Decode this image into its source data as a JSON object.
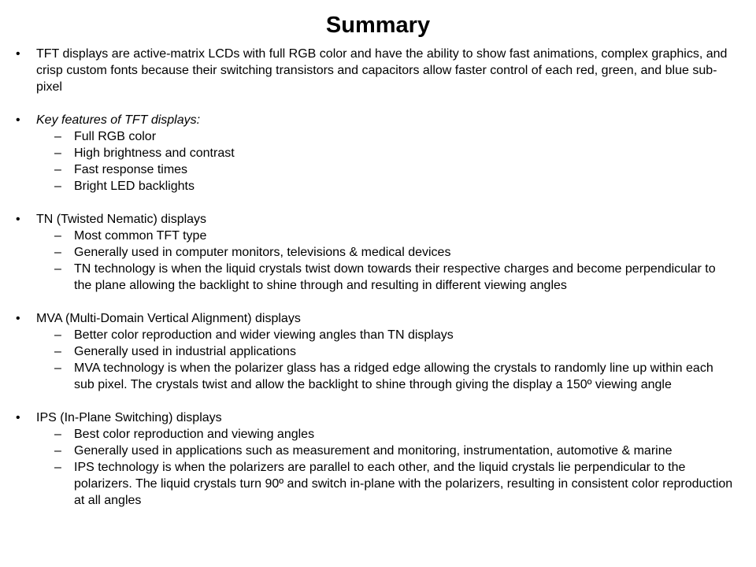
{
  "slide": {
    "title": "Summary",
    "bullet_marker": "•",
    "sub_bullet_marker": "–",
    "text_color": "#000000",
    "background_color": "#ffffff",
    "groups": [
      {
        "id": "tft-overview",
        "lead": {
          "text": "TFT displays are active-matrix LCDs with full RGB color and have the ability to show fast animations, complex graphics, and crisp custom fonts because their switching transistors and capacitors allow faster control of each red, green, and blue sub-pixel",
          "style": "normal"
        },
        "subs": []
      },
      {
        "id": "key-features",
        "lead": {
          "text": "Key features of TFT displays:",
          "style": "italic"
        },
        "subs": [
          "Full RGB color",
          "High brightness and contrast",
          "Fast response times",
          "Bright LED backlights"
        ]
      },
      {
        "id": "tn-displays",
        "lead": {
          "text": "TN (Twisted Nematic) displays",
          "style": "normal"
        },
        "subs": [
          "Most common TFT type",
          "Generally used in computer monitors, televisions & medical devices",
          "TN technology is when the liquid crystals twist down towards their respective charges and become perpendicular to the plane allowing the backlight to shine through and resulting in different viewing angles"
        ]
      },
      {
        "id": "mva-displays",
        "lead": {
          "text": "MVA (Multi-Domain Vertical Alignment) displays",
          "style": "normal"
        },
        "subs": [
          "Better color reproduction and wider viewing angles than TN displays",
          "Generally used in industrial applications",
          "MVA technology is when the polarizer glass has a ridged edge allowing the crystals to randomly line up within each sub pixel. The crystals twist and allow the backlight to shine through giving the display a 150º viewing angle"
        ]
      },
      {
        "id": "ips-displays",
        "lead": {
          "text": "IPS (In-Plane Switching) displays",
          "style": "normal"
        },
        "subs": [
          "Best color reproduction and viewing angles",
          "Generally used in applications such as measurement and monitoring, instrumentation, automotive & marine",
          "IPS technology is when the polarizers are parallel to each other, and the liquid crystals lie perpendicular to the polarizers. The liquid crystals turn 90º and switch in-plane with the polarizers, resulting in consistent color reproduction at all angles"
        ]
      }
    ]
  }
}
